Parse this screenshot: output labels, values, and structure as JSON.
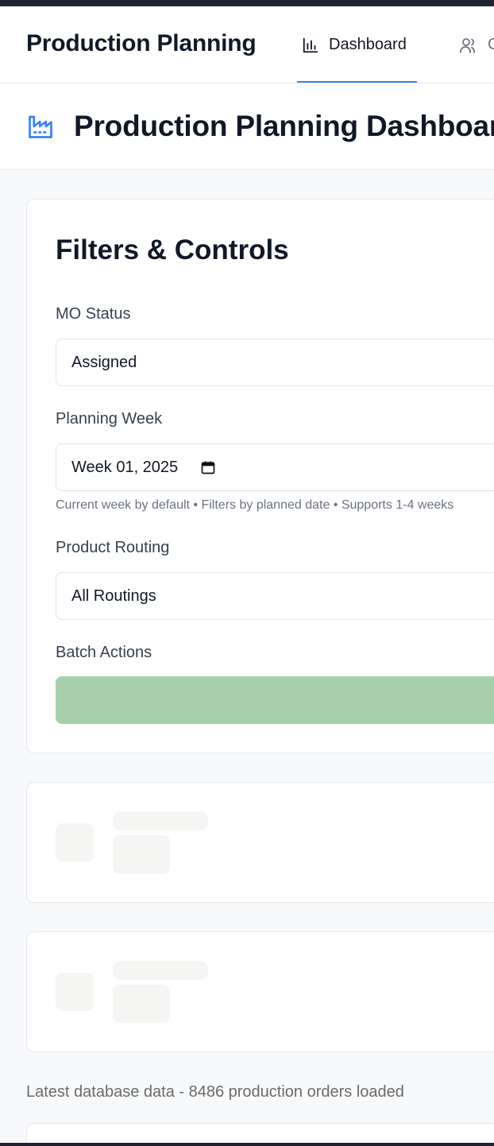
{
  "app": {
    "title": "Production Planning",
    "accent_color": "#3b82f6",
    "dark_bar_color": "#1e2333"
  },
  "nav": {
    "tabs": [
      {
        "label": "Dashboard",
        "icon": "bar-chart-icon",
        "active": true
      },
      {
        "label": "C",
        "icon": "users-icon",
        "active": false
      }
    ]
  },
  "header": {
    "title": "Production Planning Dashboard",
    "icon": "factory-icon"
  },
  "filters": {
    "title": "Filters & Controls",
    "mo_status": {
      "label": "MO Status",
      "value": "Assigned"
    },
    "planning_week": {
      "label": "Planning Week",
      "value": "Week 01, 2025",
      "hint": "Current week by default • Filters by planned date • Supports 1-4 weeks"
    },
    "product_routing": {
      "label": "Product Routing",
      "value": "All Routings"
    },
    "batch_actions": {
      "label": "Batch Actions",
      "button_color": "#a6d1a8"
    }
  },
  "status": {
    "text": "Latest database data - 8486 production orders loaded"
  }
}
